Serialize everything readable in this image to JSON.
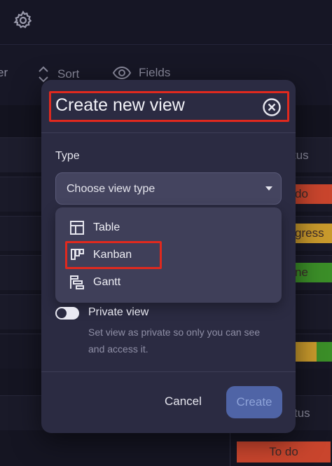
{
  "background": {
    "toolbar": {
      "filter_label": "er",
      "sort_label": "Sort",
      "fields_label": "Fields"
    },
    "column_header": "tus",
    "status_chips": [
      "do",
      "gress",
      "ne"
    ],
    "bottom_column_header": "tus",
    "bottom_chip": "To do",
    "colors": {
      "todo": "#d9412a",
      "in_progress": "#e4a21a",
      "done": "#3e9b26"
    }
  },
  "modal": {
    "title": "Create new view",
    "close_icon": "close-circle-icon",
    "type_label": "Type",
    "select_placeholder": "Choose view type",
    "options": [
      {
        "label": "Table",
        "icon": "table-icon"
      },
      {
        "label": "Kanban",
        "icon": "kanban-icon"
      },
      {
        "label": "Gantt",
        "icon": "gantt-icon"
      }
    ],
    "private_label": "Private view",
    "private_help": "Set view as private so only you can see and access it.",
    "private_enabled": false,
    "cancel_label": "Cancel",
    "create_label": "Create",
    "highlight_color": "#e0291e"
  }
}
